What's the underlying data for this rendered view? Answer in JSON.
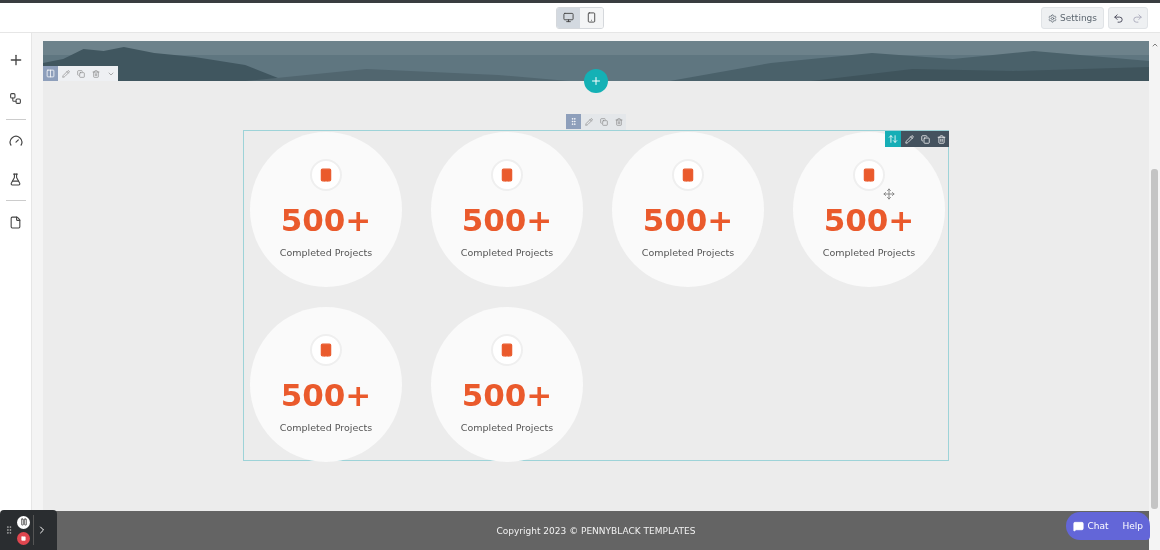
{
  "top_bar": {
    "device_toggles": [
      {
        "kind": "desktop",
        "selected": true
      },
      {
        "kind": "mobile",
        "selected": false
      }
    ],
    "settings_button": "Settings"
  },
  "stats": [
    {
      "value": "500+",
      "label": "Completed Projects"
    },
    {
      "value": "500+",
      "label": "Completed Projects"
    },
    {
      "value": "500+",
      "label": "Completed Projects"
    },
    {
      "value": "500+",
      "label": "Completed Projects"
    },
    {
      "value": "500+",
      "label": "Completed Projects"
    },
    {
      "value": "500+",
      "label": "Completed Projects"
    }
  ],
  "footer": {
    "copyright": "Copyright 2023 © PENNYBLACK TEMPLATES"
  },
  "chat_widget": {
    "chat": "Chat",
    "help": "Help"
  }
}
